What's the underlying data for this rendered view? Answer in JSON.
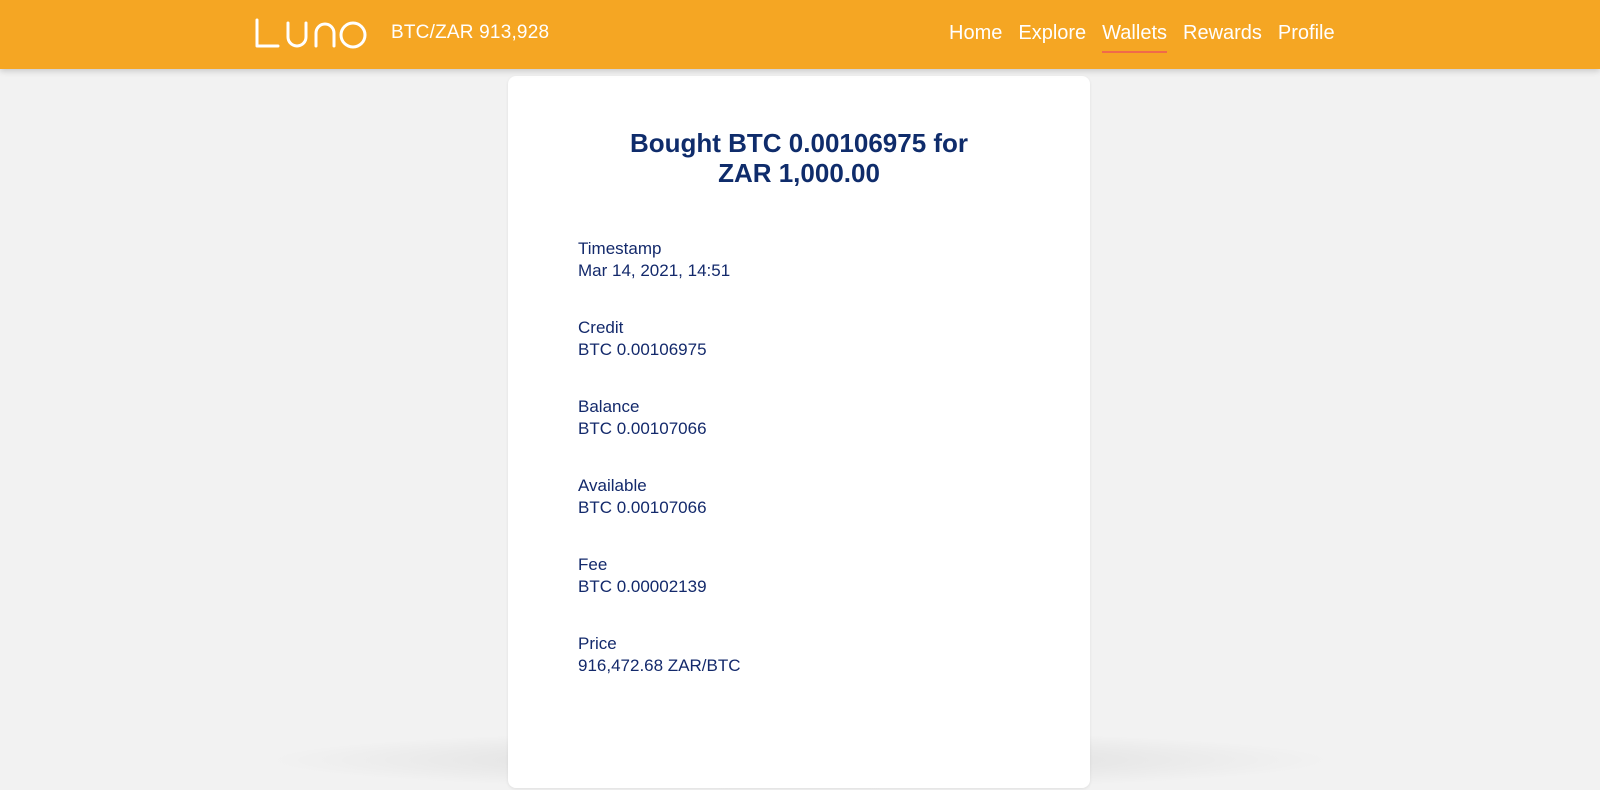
{
  "header": {
    "logo_text": "LUNO",
    "ticker": "BTC/ZAR 913,928",
    "nav": [
      {
        "label": "Home",
        "active": false
      },
      {
        "label": "Explore",
        "active": false
      },
      {
        "label": "Wallets",
        "active": true
      },
      {
        "label": "Rewards",
        "active": false
      },
      {
        "label": "Profile",
        "active": false
      }
    ]
  },
  "transaction": {
    "title_line1": "Bought BTC 0.00106975 for",
    "title_line2": "ZAR 1,000.00",
    "fields": [
      {
        "label": "Timestamp",
        "value": "Mar 14, 2021, 14:51"
      },
      {
        "label": "Credit",
        "value": "BTC 0.00106975"
      },
      {
        "label": "Balance",
        "value": "BTC 0.00107066"
      },
      {
        "label": "Available",
        "value": "BTC 0.00107066"
      },
      {
        "label": "Fee",
        "value": "BTC 0.00002139"
      },
      {
        "label": "Price",
        "value": "916,472.68 ZAR/BTC"
      }
    ]
  },
  "colors": {
    "header_bg": "#f5a623",
    "text_dark_blue": "#13296b",
    "active_underline": "#f06a4a",
    "page_bg": "#f2f2f2"
  }
}
